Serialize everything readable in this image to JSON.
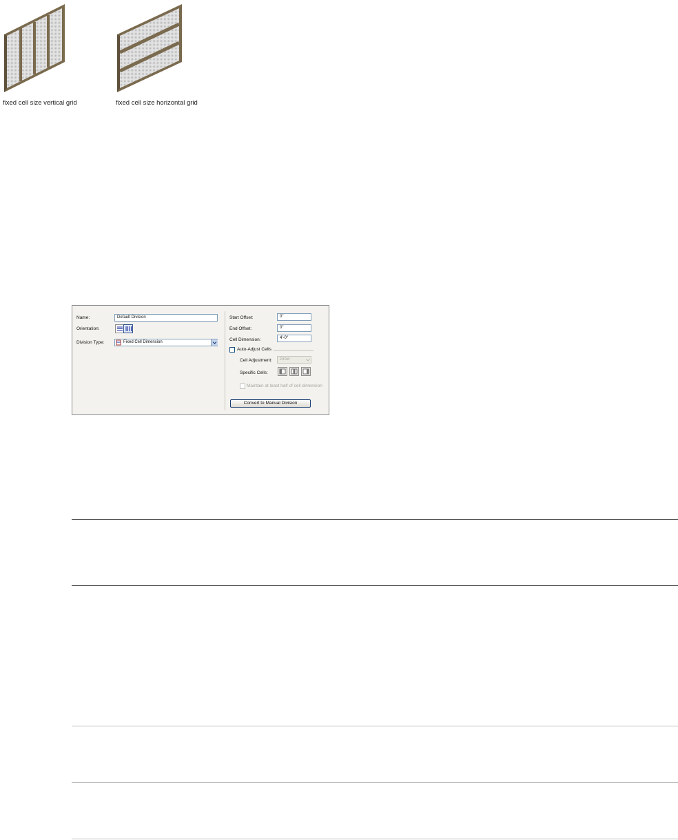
{
  "figures": {
    "vertical_caption": "fixed cell size vertical grid",
    "horizontal_caption": "fixed cell size horizontal grid"
  },
  "dialog": {
    "name_label": "Name:",
    "name_value": "Default Division",
    "orientation_label": "Orientation:",
    "orientation_selected": "vertical",
    "division_type_label": "Division Type:",
    "division_type_value": "Fixed Cell Dimension",
    "start_offset_label": "Start Offset:",
    "start_offset_value": "0\"",
    "end_offset_label": "End Offset:",
    "end_offset_value": "0\"",
    "cell_dimension_label": "Cell Dimension:",
    "cell_dimension_value": "4'-0\"",
    "auto_adjust_label": "Auto-Adjust Cells",
    "cell_adjustment_label": "Cell Adjustment:",
    "cell_adjustment_value": "Grow",
    "specific_cells_label": "Specific Cells:",
    "maintain_label": "Maintain at least half of cell dimension",
    "convert_button": "Convert to Manual Division"
  },
  "colors": {
    "frame": "#7a6a4e",
    "glass": "#d6d6d6",
    "accent": "#1c3f74"
  }
}
